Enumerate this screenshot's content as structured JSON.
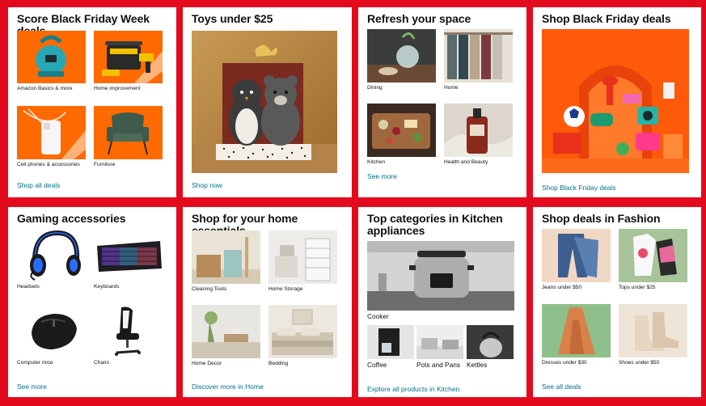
{
  "cards": {
    "black_friday_week": {
      "title": "Score Black Friday Week deals",
      "link": "Shop all deals",
      "tiles": [
        {
          "label": "Amazon Basics & more"
        },
        {
          "label": "Home improvement"
        },
        {
          "label": "Cell phones & accessories"
        },
        {
          "label": "Furniture"
        }
      ]
    },
    "toys": {
      "title": "Toys under $25",
      "link": "Shop now"
    },
    "refresh": {
      "title": "Refresh your space",
      "link": "See more",
      "tiles": [
        {
          "label": "Dining"
        },
        {
          "label": "Home"
        },
        {
          "label": "Kitchen"
        },
        {
          "label": "Health and Beauty"
        }
      ]
    },
    "black_friday_deals": {
      "title": "Shop Black Friday deals",
      "link": "Shop Black Friday deals"
    },
    "gaming": {
      "title": "Gaming accessories",
      "link": "See more",
      "tiles": [
        {
          "label": "Headsets"
        },
        {
          "label": "Keyboards"
        },
        {
          "label": "Computer mice"
        },
        {
          "label": "Chairs"
        }
      ]
    },
    "home_essentials": {
      "title": "Shop for your home essentials",
      "link": "Discover more in Home",
      "tiles": [
        {
          "label": "Cleaning Tools"
        },
        {
          "label": "Home Storage"
        },
        {
          "label": "Home Decor"
        },
        {
          "label": "Bedding"
        }
      ]
    },
    "kitchen": {
      "title": "Top categories in Kitchen appliances",
      "link": "Explore all products in Kitchen",
      "main_label": "Cooker",
      "tiles": [
        {
          "label": "Coffee"
        },
        {
          "label": "Pots and Pans"
        },
        {
          "label": "Kettles"
        }
      ]
    },
    "fashion": {
      "title": "Shop deals in Fashion",
      "link": "See all deals",
      "tiles": [
        {
          "label": "Jeans under $50"
        },
        {
          "label": "Tops under $25"
        },
        {
          "label": "Dresses under $30"
        },
        {
          "label": "Shoes under $50"
        }
      ]
    }
  },
  "colors": {
    "page_background": "#e40a1e",
    "card_background": "#ffffff",
    "link": "#007185",
    "promo_orange": "#ff6a00"
  }
}
